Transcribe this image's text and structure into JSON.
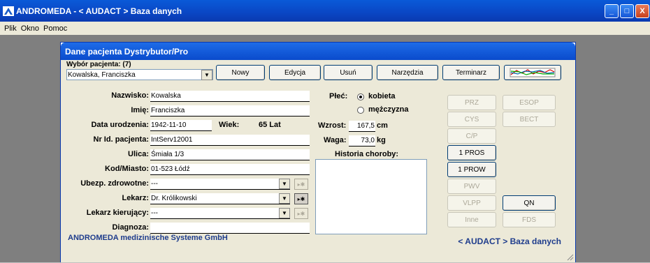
{
  "window": {
    "title": "ANDROMEDA - < AUDACT > Baza danych",
    "app_icon": "andromeda-logo-icon"
  },
  "window_controls": {
    "minimize": "_",
    "maximize": "□",
    "close": "X"
  },
  "menu": [
    "Plik",
    "Okno",
    "Pomoc"
  ],
  "dialog": {
    "title": "Dane pacjenta Dystrybutor/Pro",
    "patient_select_label": "Wybór pacjenta: (7)",
    "patient_select_value": "Kowalska, Franciszka",
    "toolbar": [
      "Nowy",
      "Edycja",
      "Usuń",
      "Narzędzia",
      "Terminarz"
    ],
    "fields": {
      "nazwisko_label": "Nazwisko:",
      "nazwisko": "Kowalska",
      "imie_label": "Imię:",
      "imie": "Franciszka",
      "data_label": "Data urodzenia:",
      "data": "1942-11-10",
      "wiek_label": "Wiek:",
      "wiek": "65 Lat",
      "nrid_label": "Nr Id. pacjenta:",
      "nrid": "IntServ12001",
      "ulica_label": "Ulica:",
      "ulica": "Śmiała 1/3",
      "kod_label": "Kod/Miasto:",
      "kod": "01-523 Łódź",
      "ubezp_label": "Ubezp. zdrowotne:",
      "ubezp": "---",
      "lekarz_label": "Lekarz:",
      "lekarz": "Dr. Królikowski",
      "kier_label": "Lekarz kierujący:",
      "kier": "---",
      "diag_label": "Diagnoza:",
      "diag": ""
    },
    "sex": {
      "label": "Płeć:",
      "female": "kobieta",
      "male": "mężczyzna",
      "selected": "kobieta"
    },
    "wzrost": {
      "label": "Wzrost:",
      "value": "167,5",
      "unit": "cm"
    },
    "waga": {
      "label": "Waga:",
      "value": "73,0",
      "unit": "kg"
    },
    "history_label": "Historia choroby:",
    "side_buttons": {
      "prz": "PRZ",
      "esop": "ESOP",
      "cys": "CYS",
      "bect": "BECT",
      "cp": "C/P",
      "pros": "1 PROS",
      "prow": "1 PROW",
      "pwv": "PWV",
      "vlpp": "VLPP",
      "qn": "QN",
      "inne": "Inne",
      "fds": "FDS"
    },
    "footer_left": "ANDROMEDA medizinische Systeme GmbH",
    "footer_right": "< AUDACT > Baza danych"
  }
}
